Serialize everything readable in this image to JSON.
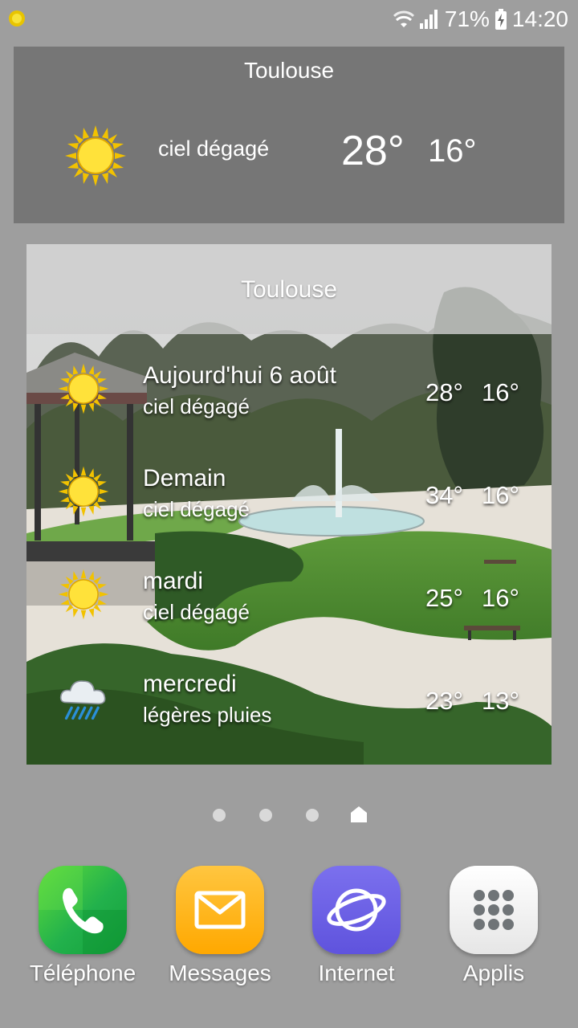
{
  "status_bar": {
    "notification_icon": "sun-icon",
    "wifi_icon": "wifi-icon",
    "signal_icon": "signal-icon",
    "battery_percent": "71%",
    "battery_icon": "battery-charging-icon",
    "time": "14:20"
  },
  "widget_current": {
    "city": "Toulouse",
    "icon": "sun-icon",
    "condition": "ciel dégagé",
    "high": "28°",
    "low": "16°"
  },
  "widget_forecast": {
    "city": "Toulouse",
    "days": [
      {
        "day": "Aujourd'hui 6 août",
        "condition": "ciel dégagé",
        "high": "28°",
        "low": "16°",
        "icon": "sun-icon"
      },
      {
        "day": "Demain",
        "condition": "ciel dégagé",
        "high": "34°",
        "low": "16°",
        "icon": "sun-icon"
      },
      {
        "day": "mardi",
        "condition": "ciel dégagé",
        "high": "25°",
        "low": "16°",
        "icon": "sun-icon"
      },
      {
        "day": "mercredi",
        "condition": "légères pluies",
        "high": "23°",
        "low": "13°",
        "icon": "rain-cloud-icon"
      }
    ]
  },
  "page_indicator": {
    "pages": 4,
    "current": 4,
    "current_icon": "home-icon"
  },
  "dock": [
    {
      "label": "Téléphone",
      "icon": "phone-icon",
      "color": "#22b14c"
    },
    {
      "label": "Messages",
      "icon": "envelope-icon",
      "color": "#ffb300"
    },
    {
      "label": "Internet",
      "icon": "planet-icon",
      "color": "#6e62e6"
    },
    {
      "label": "Applis",
      "icon": "apps-grid-icon",
      "color": "#f2f2f2"
    }
  ]
}
